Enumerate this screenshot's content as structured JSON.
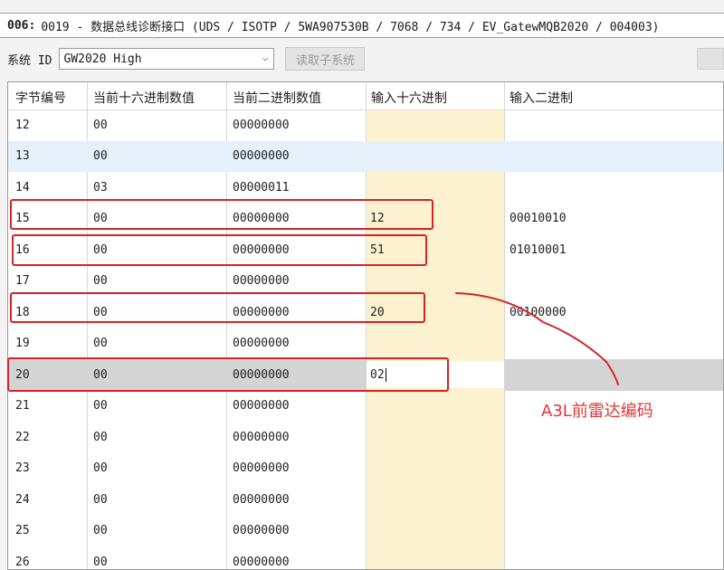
{
  "title": {
    "code": "006:",
    "text": "0019 - 数据总线诊断接口  (UDS / ISOTP / 5WA907530B / 7068 / 734 / EV_GatewMQB2020 / 004003)"
  },
  "toolbar": {
    "system_id_label": "系统 ID",
    "system_id_value": "GW2020 High",
    "read_subsystem_label": "读取子系统"
  },
  "grid": {
    "headers": [
      "字节编号",
      "当前十六进制数值",
      "当前二进制数值",
      "输入十六进制",
      "输入二进制"
    ],
    "rows": [
      {
        "byte": "12",
        "hex": "00",
        "bin": "00000000",
        "in_hex": "",
        "in_bin": ""
      },
      {
        "byte": "13",
        "hex": "00",
        "bin": "00000000",
        "in_hex": "",
        "in_bin": ""
      },
      {
        "byte": "14",
        "hex": "03",
        "bin": "00000011",
        "in_hex": "",
        "in_bin": ""
      },
      {
        "byte": "15",
        "hex": "00",
        "bin": "00000000",
        "in_hex": "12",
        "in_bin": "00010010"
      },
      {
        "byte": "16",
        "hex": "00",
        "bin": "00000000",
        "in_hex": "51",
        "in_bin": "01010001"
      },
      {
        "byte": "17",
        "hex": "00",
        "bin": "00000000",
        "in_hex": "",
        "in_bin": ""
      },
      {
        "byte": "18",
        "hex": "00",
        "bin": "00000000",
        "in_hex": "20",
        "in_bin": "00100000"
      },
      {
        "byte": "19",
        "hex": "00",
        "bin": "00000000",
        "in_hex": "",
        "in_bin": ""
      },
      {
        "byte": "20",
        "hex": "00",
        "bin": "00000000",
        "in_hex": "02",
        "in_bin": ""
      },
      {
        "byte": "21",
        "hex": "00",
        "bin": "00000000",
        "in_hex": "",
        "in_bin": ""
      },
      {
        "byte": "22",
        "hex": "00",
        "bin": "00000000",
        "in_hex": "",
        "in_bin": ""
      },
      {
        "byte": "23",
        "hex": "00",
        "bin": "00000000",
        "in_hex": "",
        "in_bin": ""
      },
      {
        "byte": "24",
        "hex": "00",
        "bin": "00000000",
        "in_hex": "",
        "in_bin": ""
      },
      {
        "byte": "25",
        "hex": "00",
        "bin": "00000000",
        "in_hex": "",
        "in_bin": ""
      },
      {
        "byte": "26",
        "hex": "00",
        "bin": "00000000",
        "in_hex": "",
        "in_bin": ""
      }
    ],
    "selected_row_byte": "13",
    "editing_row_byte": "20"
  },
  "annotation": {
    "text": "A3L前雷达编码",
    "color": "#e23636"
  },
  "colors": {
    "input_column_bg": "#fdf2cf",
    "selected_row_bg": "#e4f1fb",
    "focused_row_bg": "#d4d4d4",
    "annotation_red": "#d62424"
  }
}
